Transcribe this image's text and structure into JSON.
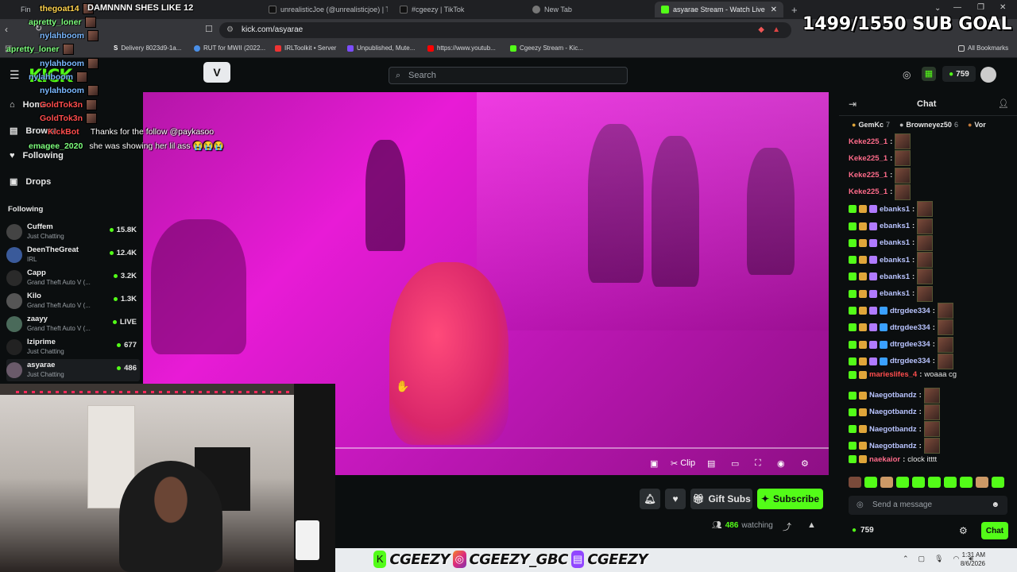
{
  "browser": {
    "tabs": [
      {
        "label": "Fin"
      },
      {
        "label": "unrealisticJoe (@unrealisticjoe) | TikT"
      },
      {
        "label": "#cgeezy | TikTok"
      },
      {
        "label": "New Tab"
      },
      {
        "label": "asyarae Stream - Watch Live"
      }
    ],
    "url": "kick.com/asyarae",
    "bookmarks": [
      "Delivery 8023d9-1a...",
      "RUT for MWII (2022...",
      "IRLToolkit • Server",
      "Unpublished, Mute...",
      "https://www.youtub...",
      "Cgeezy Stream - Kic..."
    ],
    "all_bookmarks": "All Bookmarks"
  },
  "overlay": {
    "sub_goal": "1499/1550 SUB GOAL",
    "alert": "DAMNNNN SHES LIKE 12",
    "chat": [
      {
        "user": "thegoat14",
        "text": ""
      },
      {
        "user": "apretty_loner",
        "text": ""
      },
      {
        "user": "nylahboom",
        "text": ""
      },
      {
        "user": "apretty_loner",
        "text": ""
      },
      {
        "user": "nylahboom",
        "text": ""
      },
      {
        "user": "nylahboom",
        "text": ""
      },
      {
        "user": "nylahboom",
        "text": ""
      },
      {
        "user": "GoldTok3n",
        "text": ""
      },
      {
        "user": "GoldTok3n",
        "text": ""
      },
      {
        "user": "KickBot",
        "text": "Thanks for the follow @paykasoo"
      },
      {
        "user": "emagee_2020",
        "text": "she was showing her lil ass 😭😭😭"
      }
    ]
  },
  "kick": {
    "logo": "KICK",
    "search_placeholder": "Search",
    "kicks_count": "759",
    "nav": {
      "home": "Home",
      "browse": "Browse",
      "following": "Following",
      "drops": "Drops"
    },
    "following_header": "Following",
    "following": [
      {
        "name": "Cuffem",
        "game": "Just Chatting",
        "viewers": "15.8K"
      },
      {
        "name": "DeenTheGreat",
        "game": "IRL",
        "viewers": "12.4K"
      },
      {
        "name": "Capp",
        "game": "Grand Theft Auto V (...",
        "viewers": "3.2K"
      },
      {
        "name": "Kilo",
        "game": "Grand Theft Auto V (...",
        "viewers": "1.3K"
      },
      {
        "name": "zaayy",
        "game": "Grand Theft Auto V (...",
        "viewers": "LIVE"
      },
      {
        "name": "Iziprime",
        "game": "Just Chatting",
        "viewers": "677"
      },
      {
        "name": "asyarae",
        "game": "Just Chatting",
        "viewers": "486"
      }
    ],
    "player": {
      "clip_label": "Clip"
    },
    "actions": {
      "gift_subs": "Gift Subs",
      "subscribe": "Subscribe",
      "watching_count": "486",
      "watching_label": "watching"
    },
    "chat": {
      "title": "Chat",
      "pinned": [
        {
          "user": "GemKc",
          "count": "7"
        },
        {
          "user": "Browneyez50",
          "count": "6"
        },
        {
          "user": "Vor",
          "count": ""
        }
      ],
      "messages": [
        {
          "user": "Keke225_1",
          "color": "#ff6b8a",
          "text": ""
        },
        {
          "user": "Keke225_1",
          "color": "#ff6b8a",
          "text": ""
        },
        {
          "user": "Keke225_1",
          "color": "#ff6b8a",
          "text": ""
        },
        {
          "user": "Keke225_1",
          "color": "#ff6b8a",
          "text": ""
        },
        {
          "user": "ebanks1",
          "color": "#b9c4ff",
          "text": ""
        },
        {
          "user": "ebanks1",
          "color": "#b9c4ff",
          "text": ""
        },
        {
          "user": "ebanks1",
          "color": "#b9c4ff",
          "text": ""
        },
        {
          "user": "ebanks1",
          "color": "#b9c4ff",
          "text": ""
        },
        {
          "user": "ebanks1",
          "color": "#b9c4ff",
          "text": ""
        },
        {
          "user": "ebanks1",
          "color": "#b9c4ff",
          "text": ""
        },
        {
          "user": "dtrgdee334",
          "color": "#b9c4ff",
          "text": ""
        },
        {
          "user": "dtrgdee334",
          "color": "#b9c4ff",
          "text": ""
        },
        {
          "user": "dtrgdee334",
          "color": "#b9c4ff",
          "text": ""
        },
        {
          "user": "dtrgdee334",
          "color": "#b9c4ff",
          "text": ""
        },
        {
          "user": "marieslifes_4",
          "color": "#ff4d4d",
          "text": "woaaa cg"
        },
        {
          "user": "Naegotbandz",
          "color": "#b9c4ff",
          "text": ""
        },
        {
          "user": "Naegotbandz",
          "color": "#b9c4ff",
          "text": ""
        },
        {
          "user": "Naegotbandz",
          "color": "#b9c4ff",
          "text": ""
        },
        {
          "user": "Naegotbandz",
          "color": "#b9c4ff",
          "text": ""
        },
        {
          "user": "naekaior",
          "color": "#ff6b8a",
          "text": "clock itttt"
        }
      ],
      "input_placeholder": "Send a message",
      "kicks_balance": "759",
      "send_label": "Chat"
    }
  },
  "branding": {
    "tags": [
      "CGEEZY",
      "CGEEZY_GBC",
      "CGEEZY"
    ]
  },
  "system": {
    "time": "1:31 AM",
    "date": "8/6/2026"
  },
  "colors": {
    "kick_green": "#53fc18",
    "bg": "#0b0e0f"
  }
}
